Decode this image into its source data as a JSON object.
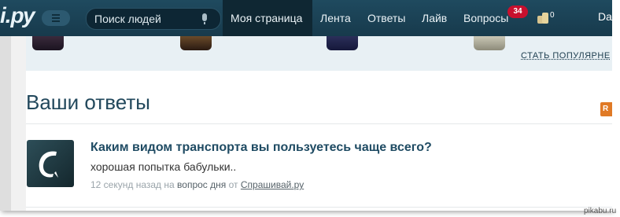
{
  "header": {
    "logo_text": "і.ру",
    "search_placeholder": "Поиск людей",
    "nav": [
      {
        "label": "Моя страница",
        "active": true
      },
      {
        "label": "Лента"
      },
      {
        "label": "Ответы"
      },
      {
        "label": "Лайв"
      },
      {
        "label": "Вопросы"
      }
    ],
    "questions_badge": "34",
    "coins_count": "0",
    "user_truncated": "Da"
  },
  "strip": {
    "link_label": "СТАТЬ ПОПУЛЯРНЕ"
  },
  "main": {
    "title": "Ваши ответы",
    "rss_label": "R",
    "answer": {
      "question": "Каким видом транспорта вы пользуетесь чаще всего?",
      "text": "хорошая попытка бабульки..",
      "time": "12 секунд назад",
      "on": "на",
      "source_type": "вопрос дня",
      "from": "от",
      "source": "Спрашивай.ру"
    }
  },
  "watermark": "pikabu.ru",
  "colors": {
    "topbar": "#1b4255",
    "accent_title": "#1f4b63",
    "badge": "#c8102e",
    "rss": "#e07a26"
  }
}
